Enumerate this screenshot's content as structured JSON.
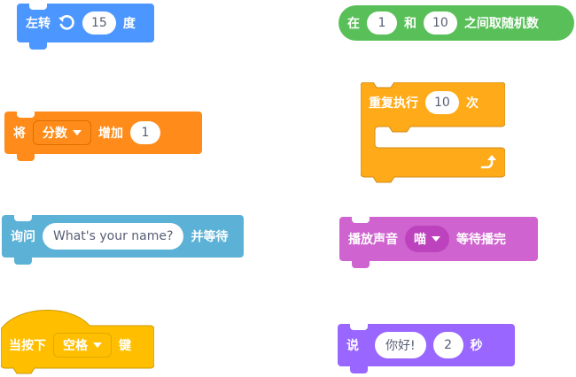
{
  "blocks": {
    "turn_left": {
      "label": "左转",
      "degrees": "15",
      "unit": "度",
      "color": "#4c97ff"
    },
    "set_var": {
      "label": "将",
      "variable": "分数",
      "action": "增加",
      "amount": "1",
      "color": "#ff8c1a"
    },
    "ask": {
      "label": "询问",
      "question": "What's your name?",
      "suffix": "并等待",
      "color": "#5cb1d6"
    },
    "when_key": {
      "label": "当按下",
      "key": "空格",
      "suffix": "键",
      "color": "#ffbf00"
    },
    "random": {
      "label_pre": "在",
      "from": "1",
      "label_mid": "和",
      "to": "10",
      "label_post": "之间取随机数",
      "color": "#59c059"
    },
    "repeat": {
      "label": "重复执行",
      "times": "10",
      "suffix": "次",
      "color": "#ffab19"
    },
    "play_sound": {
      "label": "播放声音",
      "sound": "喵",
      "suffix": "等待播完",
      "color": "#cf63cf"
    },
    "say": {
      "label": "说",
      "message": "你好!",
      "seconds": "2",
      "suffix": "秒",
      "color": "#9966ff"
    }
  }
}
